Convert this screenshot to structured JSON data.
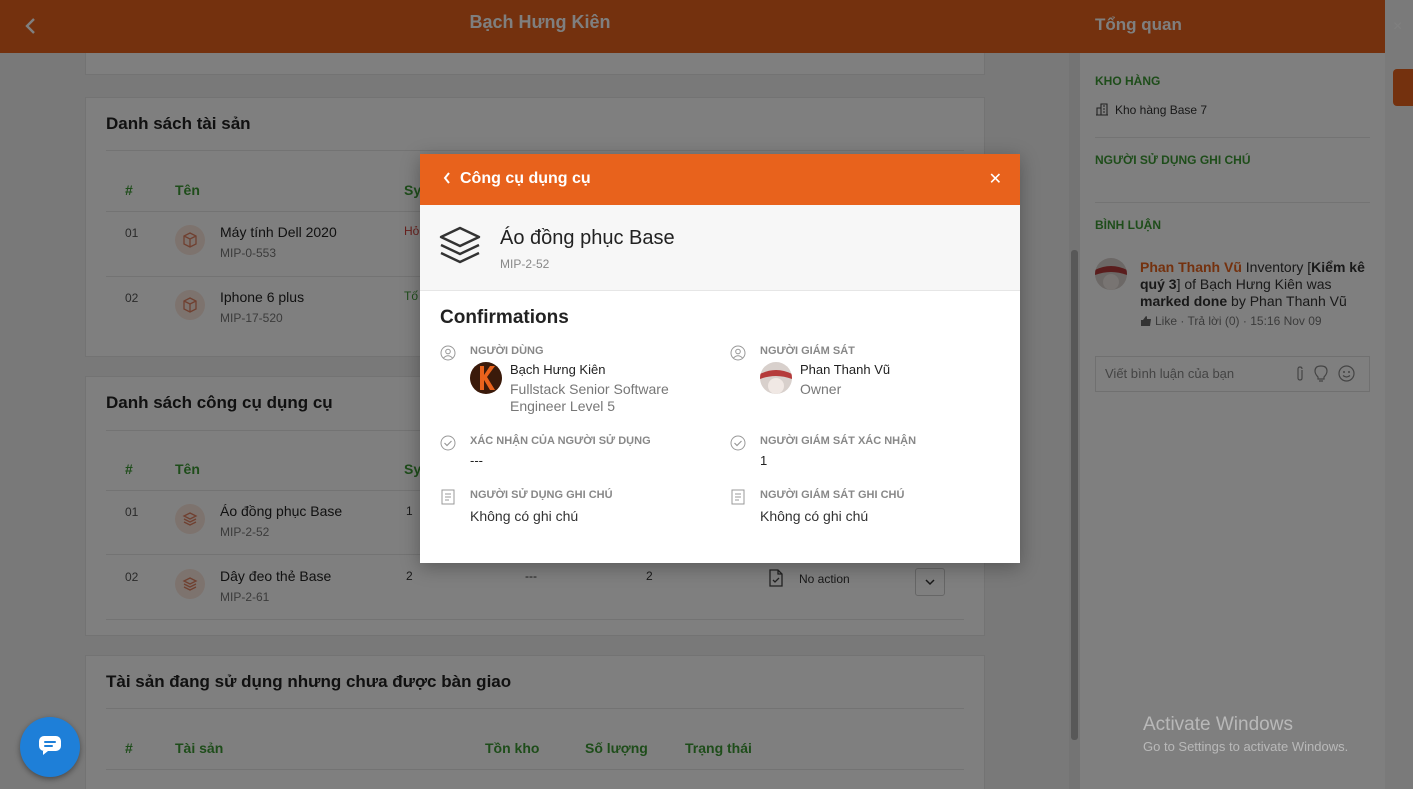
{
  "header": {
    "title": "Bạch Hưng Kiên"
  },
  "assets_card": {
    "title": "Danh sách tài sản",
    "columns": [
      "#",
      "Tên",
      "Sy"
    ],
    "rows": [
      {
        "num": "01",
        "name": "Máy tính Dell 2020",
        "code": "MIP-0-553",
        "status": "Hỏ"
      },
      {
        "num": "02",
        "name": "Iphone 6 plus",
        "code": "MIP-17-520",
        "status": "Tố"
      }
    ]
  },
  "tools_card": {
    "title": "Danh sách công cụ dụng cụ",
    "columns": [
      "#",
      "Tên",
      "Sy"
    ],
    "rows": [
      {
        "num": "01",
        "name": "Áo đồng phục Base",
        "code": "MIP-2-52",
        "c1": "1",
        "c2": "",
        "c3": "",
        "action": ""
      },
      {
        "num": "02",
        "name": "Dây đeo thẻ Base",
        "code": "MIP-2-61",
        "c1": "2",
        "c2": "---",
        "c3": "2",
        "action": "No action"
      }
    ]
  },
  "unassigned_card": {
    "title": "Tài sản đang sử dụng nhưng chưa được bàn giao",
    "columns": [
      "#",
      "Tài sản",
      "Tồn kho",
      "Số lượng",
      "Trạng thái"
    ]
  },
  "right_panel": {
    "title": "Tổng quan",
    "warehouse_label": "KHO HÀNG",
    "warehouse_value": "Kho hàng Base 7",
    "user_note_label": "NGƯỜI SỬ DỤNG GHI CHÚ",
    "comments_label": "BÌNH LUẬN",
    "comment": {
      "author": "Phan Thanh Vũ",
      "t1": " Inventory [",
      "b1": "Kiểm kê quý 3",
      "t2": "] of Bạch Hưng Kiên was ",
      "b2": "marked done",
      "t3": " by Phan Thanh Vũ",
      "meta": "Like · Trả lời (0) · 15:16 Nov 09"
    },
    "comment_placeholder": "Viết bình luận của bạn"
  },
  "modal": {
    "title": "Công cụ dụng cụ",
    "item_name": "Áo đồng phục Base",
    "item_code": "MIP-2-52",
    "section": "Confirmations",
    "user_label": "NGƯỜI DÙNG",
    "user_name": "Bạch Hưng Kiên",
    "user_role_1": "Fullstack Senior Software",
    "user_role_2": "Engineer Level 5",
    "supervisor_label": "NGƯỜI GIÁM SÁT",
    "supervisor_name": "Phan Thanh Vũ",
    "supervisor_role": "Owner",
    "user_confirm_label": "XÁC NHẬN CỦA NGƯỜI SỬ DỤNG",
    "user_confirm_value": "---",
    "supervisor_confirm_label": "NGƯỜI GIÁM SÁT XÁC NHẬN",
    "supervisor_confirm_value": "1",
    "user_note_label": "NGƯỜI SỬ DỤNG GHI CHÚ",
    "user_note_value": "Không có ghi chú",
    "supervisor_note_label": "NGƯỜI GIÁM SÁT GHI CHÚ",
    "supervisor_note_value": "Không có ghi chú"
  },
  "watermark": {
    "line1": "Activate Windows",
    "line2": "Go to Settings to activate Windows."
  },
  "colors": {
    "accent": "#e8621c",
    "green": "#3d9a35",
    "chat": "#1e7fd8"
  }
}
